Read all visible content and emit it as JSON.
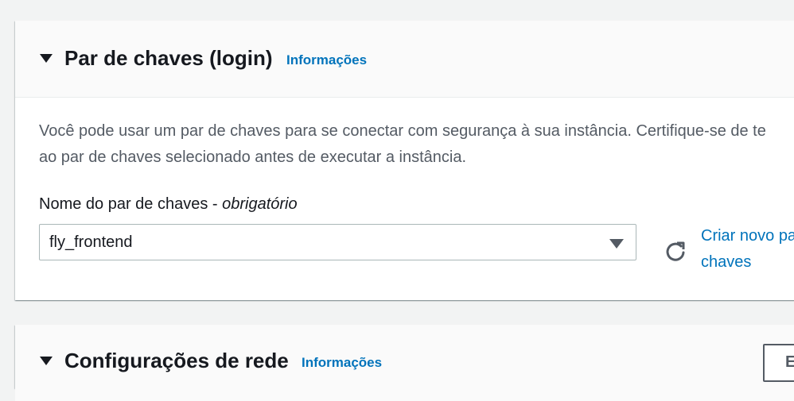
{
  "key_pair_section": {
    "title": "Par de chaves (login)",
    "info_link": "Informações",
    "description_line1": "Você pode usar um par de chaves para se conectar com segurança à sua instância. Certifique-se de te",
    "description_line2": "ao par de chaves selecionado antes de executar a instância.",
    "field_label": "Nome do par de chaves - ",
    "field_required": "obrigatório",
    "selected_key_pair": "fly_frontend",
    "create_link_line1": "Criar novo pa",
    "create_link_line2": "chaves",
    "icons": {
      "collapse": "caret-down-icon",
      "dropdown": "chevron-down-icon",
      "refresh": "refresh-icon"
    }
  },
  "network_section": {
    "title": "Configurações de rede",
    "info_link": "Informações",
    "edit_button_label": "E"
  },
  "colors": {
    "link": "#0073bb",
    "text": "#16191f",
    "secondary_text": "#545b64",
    "background": "#f2f3f3"
  }
}
